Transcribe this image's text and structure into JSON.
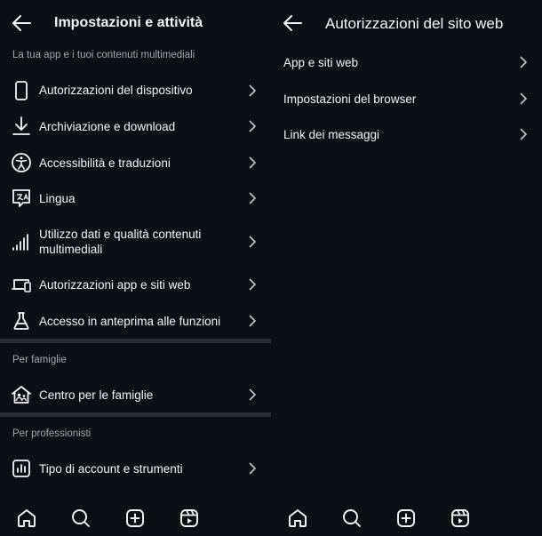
{
  "left": {
    "title": "Impostazioni e attività",
    "section1": "La tua app e i tuoi contenuti multimediali",
    "items1": [
      {
        "label": "Autorizzazioni del dispositivo",
        "icon": "phone-icon"
      },
      {
        "label": "Archiviazione e download",
        "icon": "download-icon"
      },
      {
        "label": "Accessibilità e traduzioni",
        "icon": "accessibility-icon"
      },
      {
        "label": "Lingua",
        "icon": "translate-icon"
      },
      {
        "label": "Utilizzo dati e qualità contenuti multimediali",
        "icon": "signal-icon"
      },
      {
        "label": "Autorizzazioni app e siti web",
        "icon": "laptop-phone-icon"
      },
      {
        "label": "Accesso in anteprima alle funzioni",
        "icon": "flask-icon"
      }
    ],
    "section2": "Per famiglie",
    "family_item": {
      "label": "Centro per le famiglie",
      "icon": "family-home-icon"
    },
    "section3": "Per professionisti",
    "pro_item": {
      "label": "Tipo di account e strumenti",
      "icon": "bar-chart-icon"
    }
  },
  "right": {
    "title": "Autorizzazioni del sito web",
    "items": [
      {
        "label": "App e siti web"
      },
      {
        "label": "Impostazioni del browser"
      },
      {
        "label": "Link dei messaggi"
      }
    ]
  },
  "nav": [
    "home-icon",
    "search-icon",
    "create-icon",
    "reels-icon"
  ]
}
